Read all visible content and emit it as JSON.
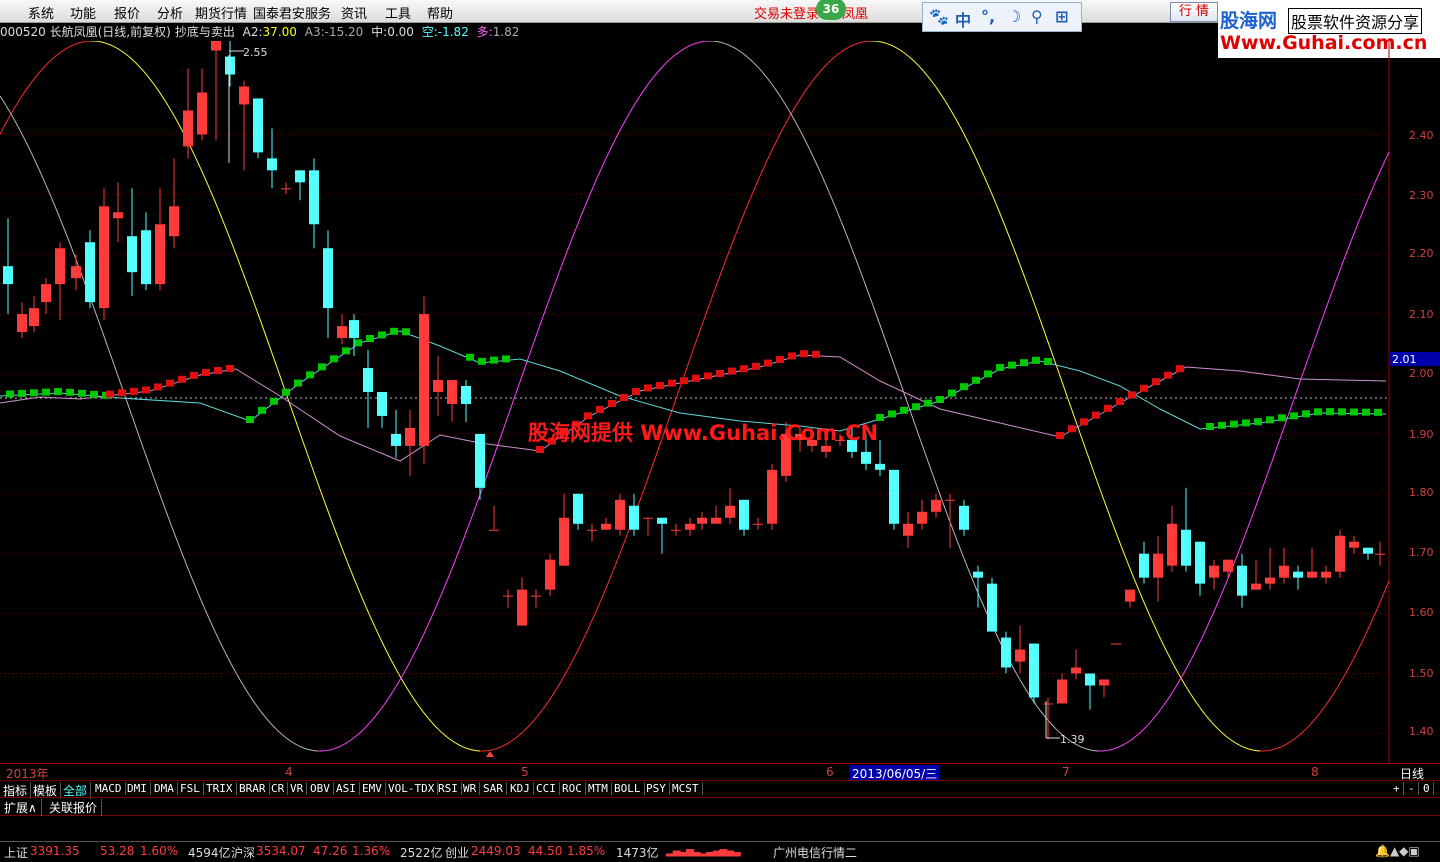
{
  "menu": [
    "系统",
    "功能",
    "报价",
    "分析",
    "期货行情",
    "国泰君安服务",
    "资讯",
    "工具",
    "帮助"
  ],
  "login_status": "交易未登录",
  "login_status2": "凤凰",
  "notify_count": "36",
  "toolbox": [
    "中",
    "°,",
    "☽",
    "⚲",
    "⊞"
  ],
  "quote_button": "行 情",
  "logo": {
    "cn": "股海网",
    "slogan": "股票软件资源分享",
    "url": "Www.Guhai.com.cn"
  },
  "info": {
    "code_name": "000520 长航凤凰(日线,前复权)",
    "indicator": "抄底与卖出",
    "a2_label": "A2:",
    "a2": "37.00",
    "a3_label": "A3:",
    "a3": "-15.20",
    "mid_label": "中:",
    "mid": "0.00",
    "kong_label": "空:",
    "kong": "-1.82",
    "duo_label": "多:",
    "duo": "1.82"
  },
  "price_labels": {
    "high": "2.55",
    "low": "1.39",
    "current": "2.01"
  },
  "y_ticks": [
    "2.40",
    "2.30",
    "2.20",
    "2.10",
    "2.00",
    "1.90",
    "1.80",
    "1.70",
    "1.60",
    "1.50",
    "1.40"
  ],
  "watermark": "股海网提供 Www.Guhai.Com.CN",
  "x_axis": {
    "start": "2013年",
    "m4": "4",
    "m5": "5",
    "m6": "6",
    "date": "2013/06/05/三",
    "m7": "7",
    "m8": "8",
    "period": "日线"
  },
  "tabs": [
    "指标",
    "模板",
    "全部",
    "MACD",
    "DMI",
    "DMA",
    "FSL",
    "TRIX",
    "BRAR",
    "CR",
    "VR",
    "OBV",
    "ASI",
    "EMV",
    "VOL-TDX",
    "RSI",
    "WR",
    "SAR",
    "KDJ",
    "CCI",
    "ROC",
    "MTM",
    "BOLL",
    "PSY",
    "MCST"
  ],
  "tab_controls": [
    "+",
    "-",
    "0"
  ],
  "expand": [
    "扩展∧",
    "关联报价"
  ],
  "status": {
    "sh_label": "上证",
    "sh": "3391.35",
    "sh_chg": "53.28",
    "sh_pct": "1.60%",
    "sh_vol": "4594亿",
    "sz_label": "沪深",
    "sz": "3534.07",
    "sz_chg": "47.26",
    "sz_pct": "1.36%",
    "sz_vol": "2522亿",
    "cy_label": "创业",
    "cy": "2449.03",
    "cy_chg": "44.50",
    "cy_pct": "1.85%",
    "cy_vol": "1473亿",
    "line": "广州电信行情二"
  },
  "colors": {
    "up": "#ff3b3b",
    "down": "#54ffff",
    "green_band": "#00c800"
  }
}
